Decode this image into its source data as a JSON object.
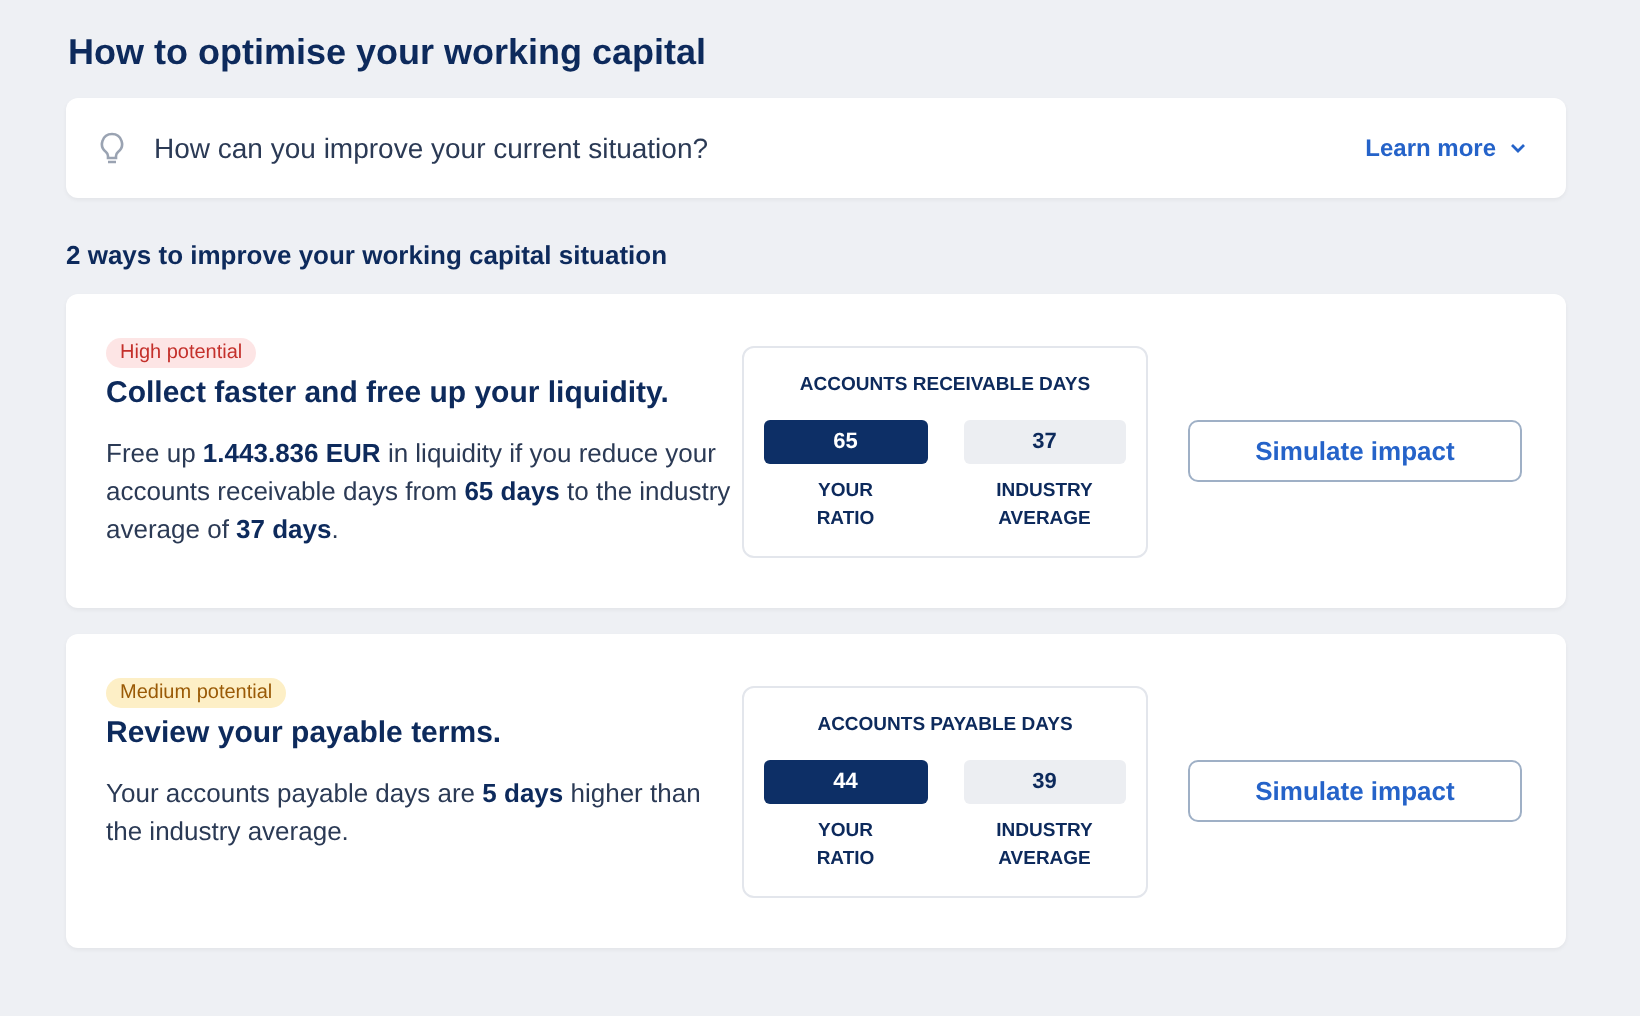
{
  "title": "How to optimise your working capital",
  "info": {
    "question": "How can you improve your current situation?",
    "link": "Learn more",
    "expanded": false
  },
  "subtitle": "2 ways to improve your working capital situation",
  "cards": [
    {
      "tag": {
        "label": "High potential",
        "kind": "high"
      },
      "heading": "Collect faster and free up your liquidity.",
      "text": "Free up **1.443.836 EUR** in liquidity if you reduce your accounts receivable days from **65 days** to the industry average of **37 days**.",
      "metric": {
        "title": "ACCOUNTS RECEIVABLE DAYS",
        "values": [
          {
            "value": "65",
            "label": "YOUR RATIO",
            "kind": "own"
          },
          {
            "value": "37",
            "label": "INDUSTRY AVERAGE",
            "kind": "benchmark"
          }
        ]
      },
      "button": "Simulate impact"
    },
    {
      "tag": {
        "label": "Medium potential",
        "kind": "medium"
      },
      "heading": "Review your payable terms.",
      "text": "Your accounts payable days are **5 days** higher than the industry average.",
      "metric": {
        "title": "ACCOUNTS PAYABLE DAYS",
        "values": [
          {
            "value": "44",
            "label": "YOUR RATIO",
            "kind": "own"
          },
          {
            "value": "39",
            "label": "INDUSTRY AVERAGE",
            "kind": "benchmark"
          }
        ]
      },
      "button": "Simulate impact"
    }
  ]
}
